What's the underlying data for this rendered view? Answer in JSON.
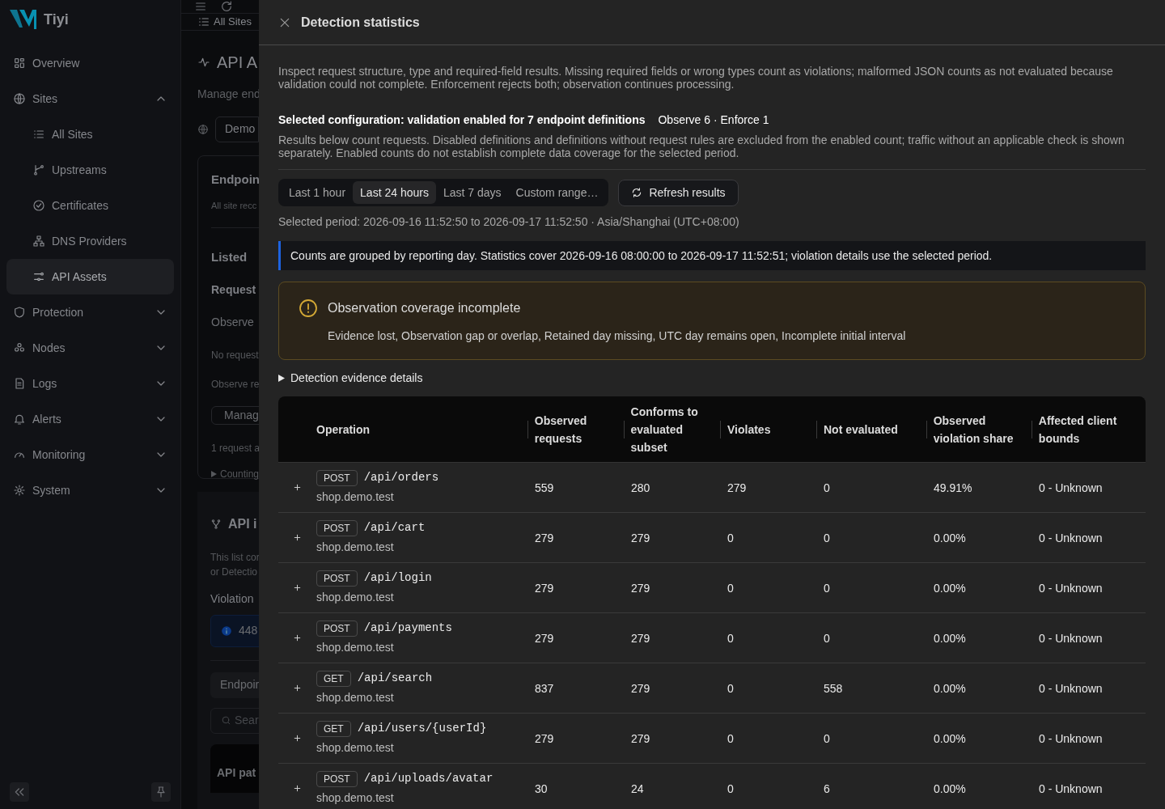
{
  "sidebar": {
    "brand": "Tiyi",
    "items": [
      {
        "label": "Overview",
        "kind": "link",
        "selected": false
      },
      {
        "label": "Sites",
        "kind": "group",
        "selected": false,
        "expanded": true,
        "children": [
          {
            "label": "All Sites",
            "selected": false
          },
          {
            "label": "Upstreams",
            "selected": false
          },
          {
            "label": "Certificates",
            "selected": false
          },
          {
            "label": "DNS Providers",
            "selected": false
          },
          {
            "label": "API Assets",
            "selected": true
          }
        ]
      },
      {
        "label": "Protection",
        "kind": "group",
        "selected": false,
        "expanded": false
      },
      {
        "label": "Nodes",
        "kind": "group",
        "selected": false,
        "expanded": false
      },
      {
        "label": "Logs",
        "kind": "group",
        "selected": false,
        "expanded": false
      },
      {
        "label": "Alerts",
        "kind": "group",
        "selected": false,
        "expanded": false
      },
      {
        "label": "Monitoring",
        "kind": "group",
        "selected": false,
        "expanded": false
      },
      {
        "label": "System",
        "kind": "group",
        "selected": false,
        "expanded": false
      }
    ]
  },
  "background_page": {
    "tab": "All Sites",
    "title": "API A",
    "subtitle": "Manage end",
    "site_select": "Demo",
    "card": {
      "title": "Endpoin",
      "subtitle": "All site recc",
      "listed": "Listed",
      "request": "Request",
      "mode": "Observe",
      "note_1": "No request",
      "note_2": "Observe re",
      "button": "Manag",
      "footer": "1 request a",
      "disclosure": "Counting"
    },
    "inventory": {
      "title": "API i",
      "description": [
        "This list cor",
        "or Detectio"
      ],
      "violation": "Violation",
      "info_count": "448",
      "tab": "Endpoir",
      "search_placeholder": "Sear",
      "column": "API pat"
    }
  },
  "drawer": {
    "title": "Detection statistics",
    "intro": "Inspect request structure, type and required-field results. Missing required fields or wrong types count as violations; malformed JSON counts as not evaluated because validation could not complete. Enforcement rejects both; observation continues processing.",
    "config_title": "Selected configuration: validation enabled for 7 endpoint definitions",
    "config_modes": "Observe 6 · Enforce 1",
    "config_note": "Results below count requests. Disabled definitions and definitions without request rules are excluded from the enabled count; traffic without an applicable check is shown separately. Enabled counts do not establish complete data coverage for the selected period.",
    "periods": [
      {
        "label": "Last 1 hour",
        "selected": false
      },
      {
        "label": "Last 24 hours",
        "selected": true
      },
      {
        "label": "Last 7 days",
        "selected": false
      },
      {
        "label": "Custom range…",
        "selected": false
      }
    ],
    "refresh_button": "Refresh results",
    "selected_period": "Selected period: 2026-09-16 11:52:50 to 2026-09-17 11:52:50 · Asia/Shanghai (UTC+08:00)",
    "info_note": "Counts are grouped by reporting day. Statistics cover 2026-09-16 08:00:00 to 2026-09-17 11:52:51; violation details use the selected period.",
    "warning": {
      "title": "Observation coverage incomplete",
      "text": "Evidence lost, Observation gap or overlap, Retained day missing, UTC day remains open, Incomplete initial interval"
    },
    "evidence_disclosure": {
      "label": "Detection evidence details",
      "expanded": false
    },
    "table": {
      "columns": [
        "Operation",
        "Observed requests",
        "Conforms to evaluated subset",
        "Violates",
        "Not evaluated",
        "Observed violation share",
        "Affected client bounds"
      ],
      "rows": [
        {
          "expanded": false,
          "operation": {
            "method": "POST",
            "path": "/api/orders",
            "host": "shop.demo.test"
          },
          "observed_requests": "559",
          "conforms_to_evaluated_subset": "280",
          "violates": "279",
          "not_evaluated": "0",
          "observed_violation_share": "49.91%",
          "affected_client_bounds": "0 - Unknown"
        },
        {
          "expanded": false,
          "operation": {
            "method": "POST",
            "path": "/api/cart",
            "host": "shop.demo.test"
          },
          "observed_requests": "279",
          "conforms_to_evaluated_subset": "279",
          "violates": "0",
          "not_evaluated": "0",
          "observed_violation_share": "0.00%",
          "affected_client_bounds": "0 - Unknown"
        },
        {
          "expanded": false,
          "operation": {
            "method": "POST",
            "path": "/api/login",
            "host": "shop.demo.test"
          },
          "observed_requests": "279",
          "conforms_to_evaluated_subset": "279",
          "violates": "0",
          "not_evaluated": "0",
          "observed_violation_share": "0.00%",
          "affected_client_bounds": "0 - Unknown"
        },
        {
          "expanded": false,
          "operation": {
            "method": "POST",
            "path": "/api/payments",
            "host": "shop.demo.test"
          },
          "observed_requests": "279",
          "conforms_to_evaluated_subset": "279",
          "violates": "0",
          "not_evaluated": "0",
          "observed_violation_share": "0.00%",
          "affected_client_bounds": "0 - Unknown"
        },
        {
          "expanded": false,
          "operation": {
            "method": "GET",
            "path": "/api/search",
            "host": "shop.demo.test"
          },
          "observed_requests": "837",
          "conforms_to_evaluated_subset": "279",
          "violates": "0",
          "not_evaluated": "558",
          "observed_violation_share": "0.00%",
          "affected_client_bounds": "0 - Unknown"
        },
        {
          "expanded": false,
          "operation": {
            "method": "GET",
            "path": "/api/users/{userId}",
            "host": "shop.demo.test"
          },
          "observed_requests": "279",
          "conforms_to_evaluated_subset": "279",
          "violates": "0",
          "not_evaluated": "0",
          "observed_violation_share": "0.00%",
          "affected_client_bounds": "0 - Unknown"
        },
        {
          "expanded": false,
          "operation": {
            "method": "POST",
            "path": "/api/uploads/avatar",
            "host": "shop.demo.test"
          },
          "observed_requests": "30",
          "conforms_to_evaluated_subset": "24",
          "violates": "0",
          "not_evaluated": "6",
          "observed_violation_share": "0.00%",
          "affected_client_bounds": "0 - Unknown"
        }
      ]
    }
  }
}
